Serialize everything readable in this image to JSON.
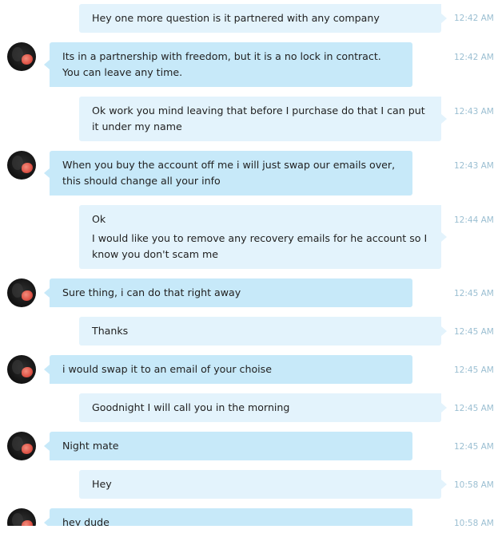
{
  "conversation": {
    "messages": [
      {
        "direction": "out",
        "lines": [
          "Hey one more question is it partnered with any company"
        ],
        "time": "12:42 AM"
      },
      {
        "direction": "in",
        "lines": [
          "Its in a partnership with freedom, but it is a no lock in contract. You can leave any time."
        ],
        "time": "12:42 AM"
      },
      {
        "direction": "out",
        "lines": [
          "Ok work you mind leaving that before I purchase do that I can put it under my name"
        ],
        "time": "12:43 AM"
      },
      {
        "direction": "in",
        "lines": [
          "When you buy the account off me i will just swap our emails over, this should change all your info"
        ],
        "time": "12:43 AM"
      },
      {
        "direction": "out",
        "lines": [
          "Ok",
          "I would like you to remove any recovery emails for he account so I know you don't scam me"
        ],
        "time": "12:44 AM"
      },
      {
        "direction": "in",
        "lines": [
          "Sure thing, i can do that right away"
        ],
        "time": "12:45 AM"
      },
      {
        "direction": "out",
        "lines": [
          "Thanks"
        ],
        "time": "12:45 AM"
      },
      {
        "direction": "in",
        "lines": [
          "i would swap it to an email of your choise"
        ],
        "time": "12:45 AM"
      },
      {
        "direction": "out",
        "lines": [
          "Goodnight I will call you in the morning"
        ],
        "time": "12:45 AM"
      },
      {
        "direction": "in",
        "lines": [
          "Night mate"
        ],
        "time": "12:45 AM"
      },
      {
        "direction": "out",
        "lines": [
          "Hey"
        ],
        "time": "10:58 AM"
      },
      {
        "direction": "in",
        "lines": [
          "hey dude"
        ],
        "time": "10:58 AM"
      }
    ]
  },
  "colors": {
    "outgoing_bubble": "#e3f3fc",
    "incoming_bubble": "#c7e9f9",
    "timestamp": "#9bbfd2"
  },
  "icons": {
    "avatar": "contact-avatar"
  }
}
